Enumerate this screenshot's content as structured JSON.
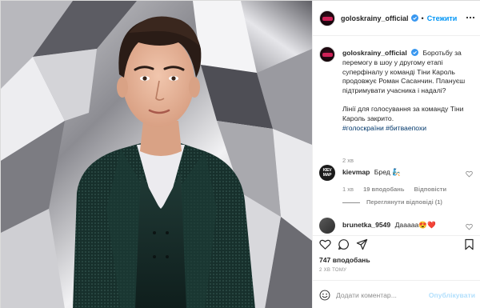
{
  "post": {
    "username": "goloskrainy_official",
    "follow_separator": "•",
    "follow_label": "Стежити"
  },
  "caption": {
    "username": "goloskrainy_official",
    "paragraph1": "Боротьбу за перемогу в шоу у другому етапі суперфіналу у команді Тіни Кароль продовжує Роман Сасанчин. Плануєш підтримувати учасника і надалі?",
    "paragraph2": "Лінії для голосування за команду Тіни Кароль закрито.",
    "hashtags": "#голоскраїни #битваепохи",
    "time": "2 хв"
  },
  "comments": [
    {
      "username": "kievmap",
      "text": "Бред 🧞",
      "avatar_text": "KIEV MAP",
      "time": "1 хв",
      "likes": "19 вподобань",
      "reply": "Відповісти"
    },
    {
      "username": "brunetka_9549",
      "text": "Дааааа😍❤️"
    }
  ],
  "view_replies": "Переглянути відповіді (1)",
  "likes_count": "747 вподобань",
  "time_ago": "2 ХВ ТОМУ",
  "comment_box": {
    "placeholder": "Додати коментар...",
    "publish_label": "Опублікувати"
  },
  "colors": {
    "link": "#0095f6",
    "hashtag": "#00376b",
    "muted": "#8e8e8e"
  }
}
